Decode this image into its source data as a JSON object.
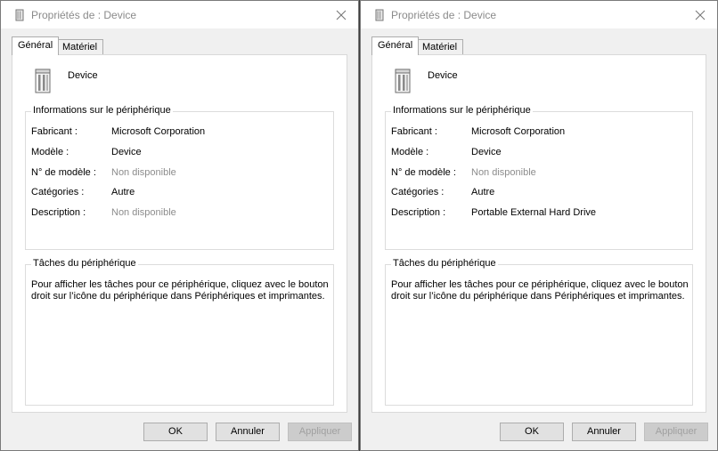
{
  "windows": [
    {
      "title": "Propriétés de : Device",
      "tabs": [
        "Général",
        "Matériel"
      ],
      "device_name": "Device",
      "info_group_label": "Informations sur le périphérique",
      "fields": [
        {
          "label": "Fabricant :",
          "value": "Microsoft Corporation",
          "available": true
        },
        {
          "label": "Modèle :",
          "value": "Device",
          "available": true
        },
        {
          "label": "N° de modèle :",
          "value": "Non disponible",
          "available": false
        },
        {
          "label": "Catégories :",
          "value": "Autre",
          "available": true
        },
        {
          "label": "Description :",
          "value": "Non disponible",
          "available": false
        }
      ],
      "tasks_group_label": "Tâches du périphérique",
      "tasks_text": "Pour afficher les tâches pour ce périphérique, cliquez avec le bouton droit sur l’icône du périphérique dans Périphériques et imprimantes.",
      "buttons": {
        "ok": "OK",
        "cancel": "Annuler",
        "apply": "Appliquer"
      }
    },
    {
      "title": "Propriétés de : Device",
      "tabs": [
        "Général",
        "Matériel"
      ],
      "device_name": "Device",
      "info_group_label": "Informations sur le périphérique",
      "fields": [
        {
          "label": "Fabricant :",
          "value": "Microsoft Corporation",
          "available": true
        },
        {
          "label": "Modèle :",
          "value": "Device",
          "available": true
        },
        {
          "label": "N° de modèle :",
          "value": "Non disponible",
          "available": false
        },
        {
          "label": "Catégories :",
          "value": "Autre",
          "available": true
        },
        {
          "label": "Description :",
          "value": "Portable External Hard Drive",
          "available": true
        }
      ],
      "tasks_group_label": "Tâches du périphérique",
      "tasks_text": "Pour afficher les tâches pour ce périphérique, cliquez avec le bouton droit sur l’icône du périphérique dans Périphériques et imprimantes.",
      "buttons": {
        "ok": "OK",
        "cancel": "Annuler",
        "apply": "Appliquer"
      }
    }
  ],
  "icons": {
    "title": "device-icon",
    "close": "close-icon",
    "device": "hard-drive-icon"
  },
  "colors": {
    "disabled_text": "#8c8c8c",
    "window_bg": "#f0f0f0"
  }
}
